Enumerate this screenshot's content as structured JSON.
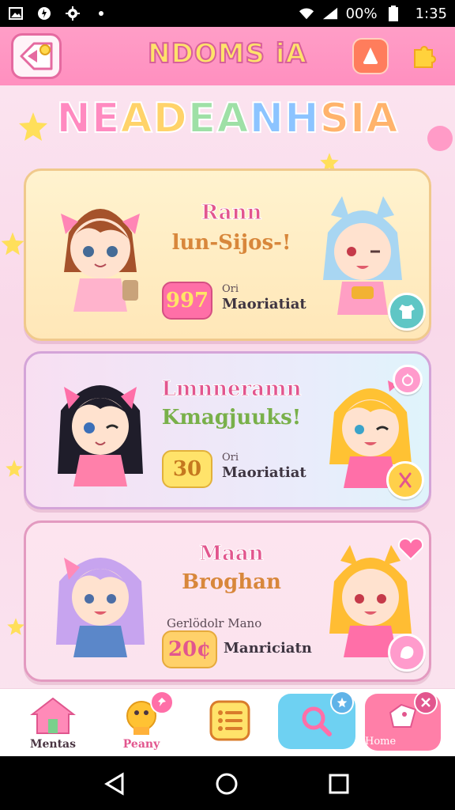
{
  "status_bar": {
    "battery": "00%",
    "time": "1:35"
  },
  "header": {
    "title": "NDOMS iA"
  },
  "banner": {
    "text_parts": [
      "NE",
      "AD",
      "EA",
      "NH",
      "SIA"
    ],
    "colors": [
      "#ff8ac0",
      "#ffd36a",
      "#9ee0a6",
      "#8cc4ff",
      "#ffb36b"
    ]
  },
  "cards": [
    {
      "title_a": "Rann",
      "title_b": "lun-Sijos-!",
      "badge": "997",
      "meta_top": "Ori",
      "meta_label": "Maoriatiat",
      "title_b_color": "#d8873b",
      "badge_bg": "#ff6fa7",
      "badge_fg": "#ffe566",
      "action_bg": "#5fc6c5"
    },
    {
      "title_a": "Lmnneramn",
      "title_b": "Kmagjuuks!",
      "badge": "30",
      "meta_top": "Ori",
      "meta_label": "Maoriatiat",
      "title_b_color": "#79b04a",
      "badge_bg": "#ffe36a",
      "badge_fg": "#c5781f",
      "action_bg": "#ffd04a"
    },
    {
      "title_a": "Maan",
      "title_b": "Broghan",
      "badge": "20¢",
      "meta_top": "Gerlödolr Mano",
      "meta_label": "Manriciatn",
      "title_b_color": "#d8873b",
      "badge_bg": "#ffd16a",
      "badge_fg": "#e2568e",
      "action_bg": "#ff9bcc"
    }
  ],
  "bottom_nav": {
    "items": [
      {
        "label": "Mentas",
        "icon": "house-icon"
      },
      {
        "label": "Peany",
        "icon": "toy-icon"
      },
      {
        "label": "",
        "icon": "list-icon"
      }
    ],
    "search_icon": "search-icon",
    "home_label": "Home"
  },
  "colors": {
    "accent": "#ff8fbf",
    "header_title": "#ffe26b",
    "title_pink": "#e2568e"
  }
}
